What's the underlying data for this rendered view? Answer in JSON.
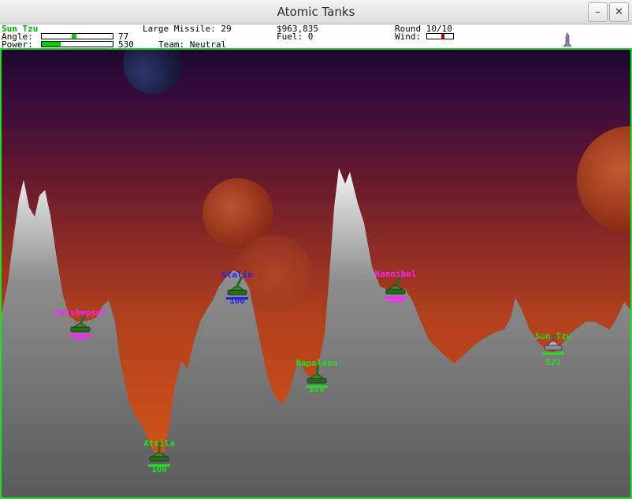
{
  "window": {
    "title": "Atomic Tanks"
  },
  "hud": {
    "player_name": "Sun Tzu",
    "angle_label": "Angle:",
    "angle_value": "77",
    "angle_level": 0.45,
    "power_label": "Power:",
    "power_value": "530",
    "power_level": 0.27,
    "weapon": "Large Missile: 29",
    "team": "Team: Neutral",
    "money": "$963,835",
    "fuel": "Fuel: 0",
    "round": "Round 10/10",
    "wind_label": "Wind:",
    "wind_level": 0.6
  },
  "tanks": [
    {
      "name": "Hatshepsut",
      "health": "80",
      "color": "#ff22ff"
    },
    {
      "name": "Stalin",
      "health": "100",
      "color": "#2222ee"
    },
    {
      "name": "Hannibal",
      "health": "100",
      "color": "#ff22ff"
    },
    {
      "name": "Napoleon",
      "health": "100",
      "color": "#22dd22"
    },
    {
      "name": "Sun Tzu",
      "health": "521",
      "color": "#22dd22"
    },
    {
      "name": "Attila",
      "health": "100",
      "color": "#22dd22"
    }
  ],
  "colors": {
    "sky_top": "#2a0a3a",
    "sky_mid": "#6a1a2a",
    "sky_bottom": "#c84a18",
    "hud_accent": "#00d000",
    "frame": "#22dd22"
  }
}
